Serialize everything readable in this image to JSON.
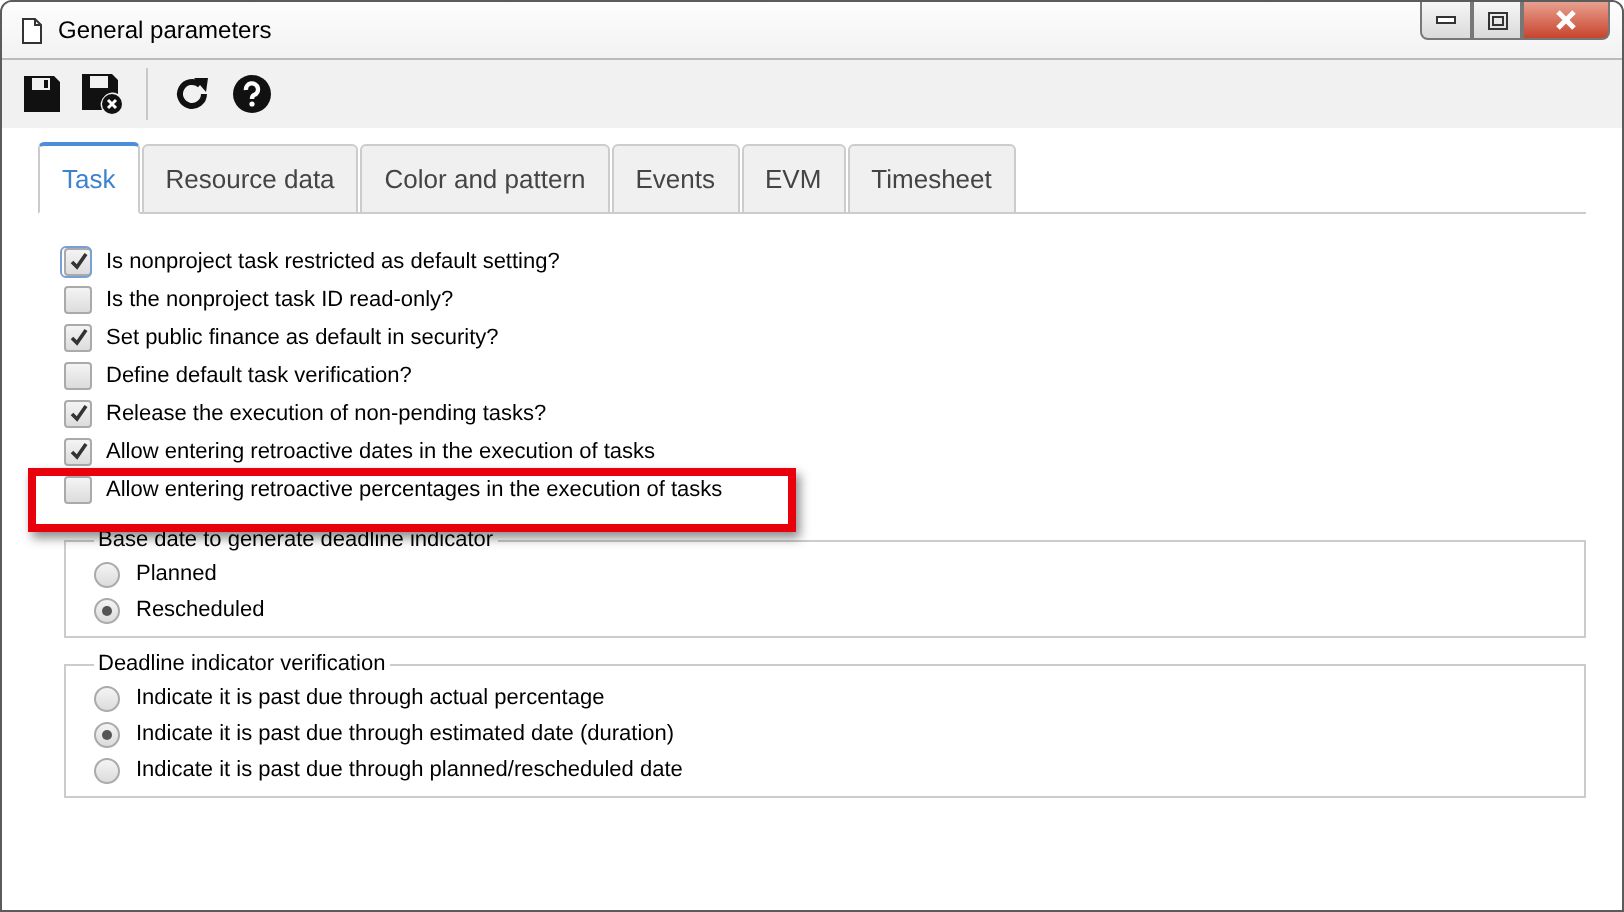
{
  "window": {
    "title": "General parameters"
  },
  "toolbar": [
    {
      "kind": "save"
    },
    {
      "kind": "save-close"
    },
    {
      "kind": "separator"
    },
    {
      "kind": "refresh"
    },
    {
      "kind": "help"
    }
  ],
  "tabs": [
    {
      "label": "Task",
      "selected": true
    },
    {
      "label": "Resource data",
      "selected": false
    },
    {
      "label": "Color and pattern",
      "selected": false
    },
    {
      "label": "Events",
      "selected": false
    },
    {
      "label": "EVM",
      "selected": false
    },
    {
      "label": "Timesheet",
      "selected": false
    }
  ],
  "options": [
    {
      "label": "Is nonproject task restricted as default setting?",
      "checked": true,
      "focused": true,
      "highlighted": false
    },
    {
      "label": "Is the nonproject task ID read-only?",
      "checked": false,
      "focused": false,
      "highlighted": false
    },
    {
      "label": "Set public finance as default in security?",
      "checked": true,
      "focused": false,
      "highlighted": false
    },
    {
      "label": "Define default task verification?",
      "checked": false,
      "focused": false,
      "highlighted": false
    },
    {
      "label": "Release the execution of non-pending tasks?",
      "checked": true,
      "focused": false,
      "highlighted": false
    },
    {
      "label": "Allow entering retroactive dates in the execution of tasks",
      "checked": true,
      "focused": false,
      "highlighted": false
    },
    {
      "label": "Allow entering retroactive percentages in the execution of tasks",
      "checked": false,
      "focused": false,
      "highlighted": true
    }
  ],
  "groups": [
    {
      "legend": "Base date to generate deadline indicator",
      "choices": [
        {
          "label": "Planned",
          "selected": false
        },
        {
          "label": "Rescheduled",
          "selected": true
        }
      ]
    },
    {
      "legend": "Deadline indicator verification",
      "choices": [
        {
          "label": "Indicate it is past due through actual percentage",
          "selected": false
        },
        {
          "label": "Indicate it is past due through estimated date (duration)",
          "selected": true
        },
        {
          "label": "Indicate it is past due through planned/rescheduled date",
          "selected": false
        }
      ]
    }
  ]
}
